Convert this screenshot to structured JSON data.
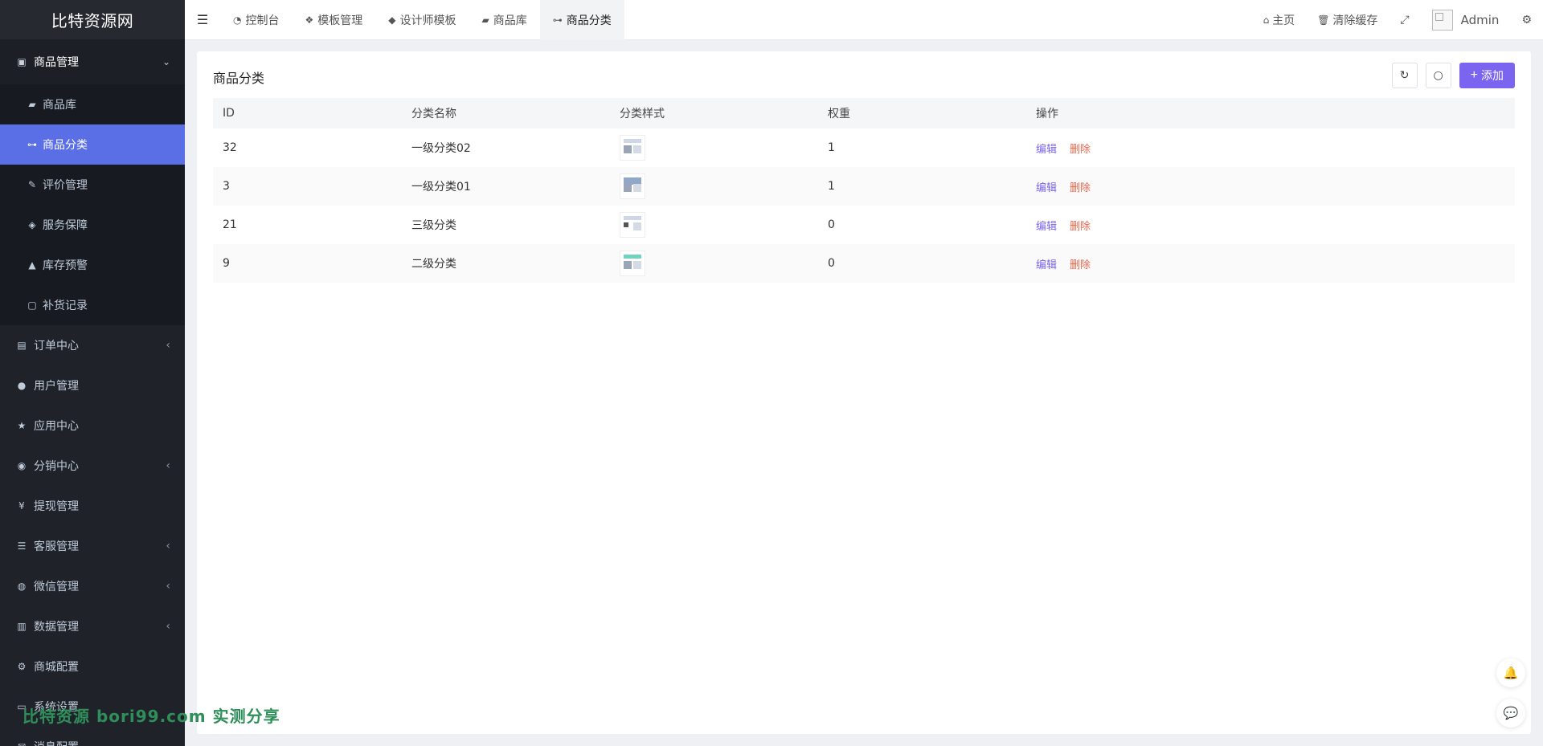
{
  "sidebar": {
    "logo": "比特资源网",
    "group": {
      "label": "商品管理",
      "arrow": "⌄"
    },
    "subitems": [
      {
        "label": "商品库",
        "icon": "bag-icon"
      },
      {
        "label": "商品分类",
        "icon": "sitemap-icon",
        "active": true
      },
      {
        "label": "评价管理",
        "icon": "edit-icon"
      },
      {
        "label": "服务保障",
        "icon": "tags-icon"
      },
      {
        "label": "库存预警",
        "icon": "warning-icon"
      },
      {
        "label": "补货记录",
        "icon": "note-icon"
      }
    ],
    "items": [
      {
        "label": "订单中心",
        "has_arrow": true
      },
      {
        "label": "用户管理",
        "has_arrow": false
      },
      {
        "label": "应用中心",
        "has_arrow": false
      },
      {
        "label": "分销中心",
        "has_arrow": true
      },
      {
        "label": "提现管理",
        "has_arrow": false
      },
      {
        "label": "客服管理",
        "has_arrow": true
      },
      {
        "label": "微信管理",
        "has_arrow": true
      },
      {
        "label": "数据管理",
        "has_arrow": true
      },
      {
        "label": "商城配置",
        "has_arrow": false
      },
      {
        "label": "系统设置",
        "has_arrow": false
      },
      {
        "label": "消息配置",
        "has_arrow": false
      }
    ]
  },
  "topbar": {
    "tabs": [
      {
        "label": "控制台",
        "icon": "dashboard-icon"
      },
      {
        "label": "模板管理",
        "icon": "cubes-icon"
      },
      {
        "label": "设计师模板",
        "icon": "cube-icon"
      },
      {
        "label": "商品库",
        "icon": "bag-icon"
      },
      {
        "label": "商品分类",
        "icon": "sitemap-icon",
        "active": true
      }
    ],
    "home": "主页",
    "clear_cache": "清除缓存",
    "user": "Admin"
  },
  "main": {
    "title": "商品分类",
    "add_label": "添加",
    "columns": [
      "ID",
      "分类名称",
      "分类样式",
      "权重",
      "操作"
    ],
    "rows": [
      {
        "id": "32",
        "name": "一级分类02",
        "weight": "1"
      },
      {
        "id": "3",
        "name": "一级分类01",
        "weight": "1"
      },
      {
        "id": "21",
        "name": "三级分类",
        "weight": "0"
      },
      {
        "id": "9",
        "name": "二级分类",
        "weight": "0"
      }
    ],
    "edit_label": "编辑",
    "delete_label": "删除"
  },
  "watermark": "比特资源 bori99.com 实测分享",
  "colors": {
    "accent": "#7b64ef",
    "active_menu": "#5a6ee5",
    "delete": "#f0654b",
    "sidebar": "#20222a"
  }
}
